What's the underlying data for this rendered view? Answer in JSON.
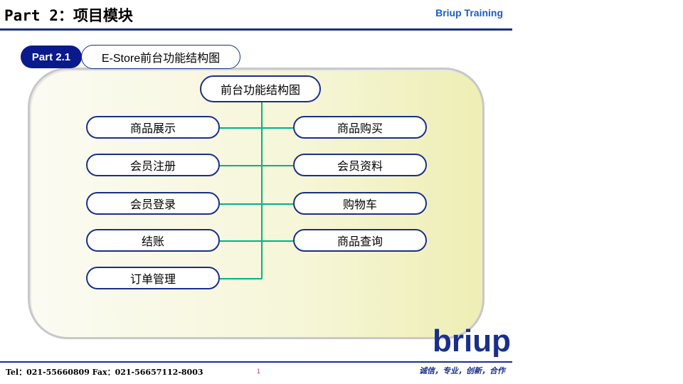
{
  "header": {
    "title": "Part 2：项目模块",
    "brand": "Briup Training"
  },
  "section": {
    "badge": "Part 2.1",
    "title": "E-Store前台功能结构图"
  },
  "diagram": {
    "root": "前台功能结构图",
    "left": [
      "商品展示",
      "会员注册",
      "会员登录",
      "结账",
      "订单管理"
    ],
    "right": [
      "商品购买",
      "会员资料",
      "购物车",
      "商品查询"
    ],
    "connector_color": "#00b386"
  },
  "logo": {
    "text": "briup"
  },
  "footer": {
    "contact": "Tel：021-55660809    Fax：021-56657112-8003",
    "page": "1",
    "slogan": "诚信，专业，创新，合作"
  }
}
